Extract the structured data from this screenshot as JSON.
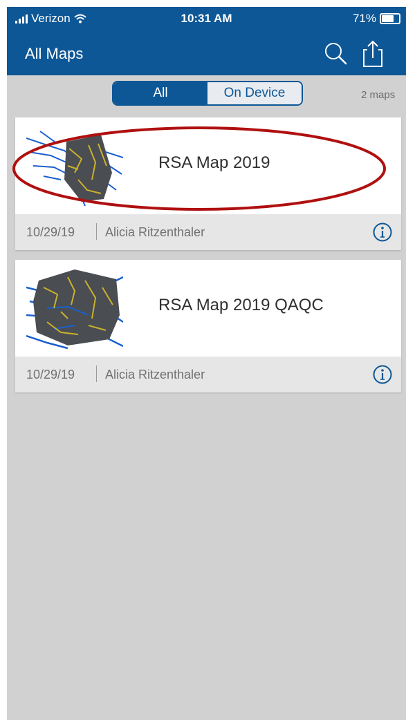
{
  "status_bar": {
    "carrier": "Verizon",
    "time": "10:31 AM",
    "battery_percent_label": "71%",
    "battery_level": 0.71
  },
  "header": {
    "title": "All Maps",
    "search_icon": "search-icon",
    "share_icon": "share-icon"
  },
  "filter": {
    "options": [
      "All",
      "On Device"
    ],
    "selected": "All",
    "count_label": "2 maps"
  },
  "maps": [
    {
      "title": "RSA Map 2019",
      "date": "10/29/19",
      "owner": "Alicia Ritzenthaler",
      "info_icon": "info-icon",
      "highlighted": true
    },
    {
      "title": "RSA Map 2019 QAQC",
      "date": "10/29/19",
      "owner": "Alicia Ritzenthaler",
      "info_icon": "info-icon",
      "highlighted": false
    }
  ],
  "colors": {
    "brand": "#0d5796",
    "background": "#d1d1d1",
    "card_footer": "#e6e6e6",
    "highlight_ring": "#b01010"
  }
}
